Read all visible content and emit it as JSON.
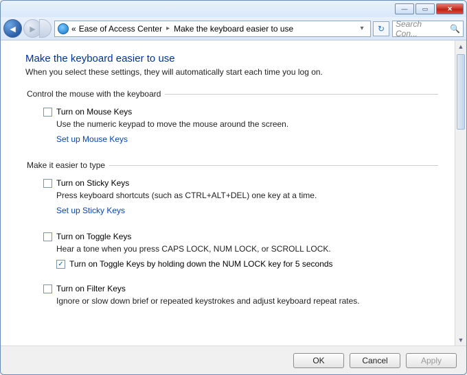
{
  "window_controls": {
    "minimize": "—",
    "maximize": "▭",
    "close": "✕"
  },
  "breadcrumb": {
    "chevrons": "«",
    "item1": "Ease of Access Center",
    "sep": "▸",
    "item2": "Make the keyboard easier to use",
    "dropdown": "▾"
  },
  "refresh_glyph": "↻",
  "search": {
    "placeholder": "Search Con...",
    "icon": "🔍"
  },
  "page": {
    "title": "Make the keyboard easier to use",
    "subtitle": "When you select these settings, they will automatically start each time you log on."
  },
  "group1": {
    "legend": "Control the mouse with the keyboard",
    "cb_label": "Turn on Mouse Keys",
    "desc": "Use the numeric keypad to move the mouse around the screen.",
    "link": "Set up Mouse Keys"
  },
  "group2": {
    "legend": "Make it easier to type",
    "sticky": {
      "cb_label": "Turn on Sticky Keys",
      "desc": "Press keyboard shortcuts (such as CTRL+ALT+DEL) one key at a time.",
      "link": "Set up Sticky Keys"
    },
    "toggle": {
      "cb_label": "Turn on Toggle Keys",
      "desc": "Hear a tone when you press CAPS LOCK, NUM LOCK, or SCROLL LOCK.",
      "sub_cb_label": "Turn on Toggle Keys by holding down the NUM LOCK key for 5 seconds",
      "sub_checked": true
    },
    "filter": {
      "cb_label": "Turn on Filter Keys",
      "desc": "Ignore or slow down brief or repeated keystrokes and adjust keyboard repeat rates."
    }
  },
  "footer": {
    "ok": "OK",
    "cancel": "Cancel",
    "apply": "Apply"
  }
}
